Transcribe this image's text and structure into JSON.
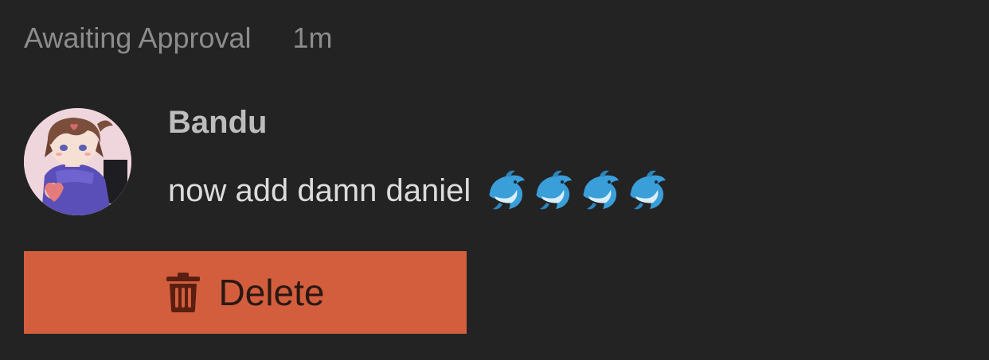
{
  "status": {
    "label": "Awaiting Approval",
    "time": "1m"
  },
  "post": {
    "author": "Bandu",
    "text": "now add damn daniel",
    "emojis": [
      "dolphin-emoji",
      "dolphin-emoji",
      "dolphin-emoji",
      "dolphin-emoji"
    ]
  },
  "actions": {
    "delete_label": "Delete",
    "delete_icon": "trash-icon",
    "delete_color": "#d25e3d"
  },
  "colors": {
    "background": "#232323",
    "muted_text": "#8c8c8c",
    "author_text": "#bdbdbd",
    "body_text": "#dcdcdc"
  }
}
